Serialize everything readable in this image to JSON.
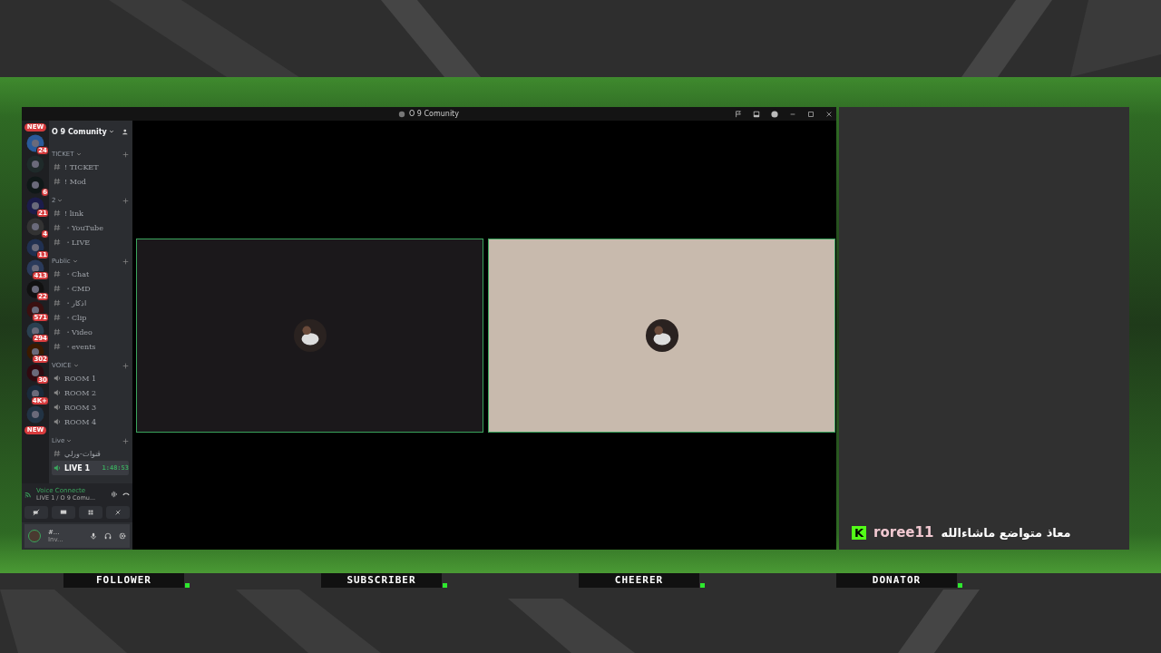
{
  "window": {
    "title": "O 9 Comunity"
  },
  "new_badges": [
    "NEW",
    "NEW"
  ],
  "servers": [
    {
      "color": "#2a5a9a",
      "badge": "24"
    },
    {
      "color": "#1f2a2a"
    },
    {
      "color": "#101818",
      "badge": "6"
    },
    {
      "color": "#1c1c4a",
      "badge": "21"
    },
    {
      "color": "#333333",
      "badge": "4"
    },
    {
      "color": "#203050",
      "badge": "11"
    },
    {
      "color": "#2a3a5a",
      "badge": "413"
    },
    {
      "color": "#111111",
      "badge": "22"
    },
    {
      "color": "#3a1010",
      "badge": "571"
    },
    {
      "color": "#2a4050",
      "badge": "294"
    },
    {
      "color": "#3a1a00",
      "badge": "302"
    },
    {
      "color": "#300a10",
      "badge": "30"
    },
    {
      "color": "#1a2a3a",
      "badge": "4K+"
    },
    {
      "color": "#223344"
    }
  ],
  "server_name": "O 9 Comunity",
  "categories": [
    {
      "name": "TICKET",
      "channels": [
        {
          "kind": "text",
          "name": "! TICKET",
          "selected": false
        },
        {
          "kind": "text",
          "name": "! Mod",
          "selected": false
        }
      ]
    },
    {
      "name": "2",
      "channels": [
        {
          "kind": "text",
          "name": "! link",
          "selected": false
        },
        {
          "kind": "text",
          "name": "・YouTube",
          "selected": false
        },
        {
          "kind": "text",
          "name": "・LIVE",
          "selected": false
        }
      ]
    },
    {
      "name": "Public",
      "channels": [
        {
          "kind": "text",
          "name": "・Chat",
          "selected": false
        },
        {
          "kind": "text",
          "name": "・CMD",
          "selected": false
        },
        {
          "kind": "text",
          "name": "・اذكار",
          "selected": false
        },
        {
          "kind": "text",
          "name": "・Clip",
          "selected": false
        },
        {
          "kind": "text",
          "name": "・Video",
          "selected": false
        },
        {
          "kind": "text",
          "name": "・events",
          "selected": false
        }
      ]
    },
    {
      "name": "VOICE",
      "channels": [
        {
          "kind": "voice",
          "name": "ROOM 1",
          "selected": false
        },
        {
          "kind": "voice",
          "name": "ROOM 2",
          "selected": false
        },
        {
          "kind": "voice",
          "name": "ROOM 3",
          "selected": false
        },
        {
          "kind": "voice",
          "name": "ROOM 4",
          "selected": false
        }
      ]
    },
    {
      "name": "Live",
      "channels": [
        {
          "kind": "text",
          "name": "قنوات-ورلي",
          "selected": false
        },
        {
          "kind": "voice",
          "name": "LIVE 1",
          "selected": true,
          "timer": "1:48:53"
        }
      ]
    }
  ],
  "voice_panel": {
    "status": "Voice Connecte",
    "channel": "LIVE 1 / O 9 Comu..."
  },
  "user_panel": {
    "name": "#...",
    "status": "Inv..."
  },
  "video_tiles": [
    {
      "color": "#1b181b"
    },
    {
      "color": "#c8baad"
    }
  ],
  "chat": {
    "badge": "K",
    "user": "roree11",
    "message": "معاذ متواضع ماشاءالله"
  },
  "labels": [
    "FOLLOWER",
    "SUBSCRIBER",
    "CHEERER",
    "DONATOR"
  ]
}
